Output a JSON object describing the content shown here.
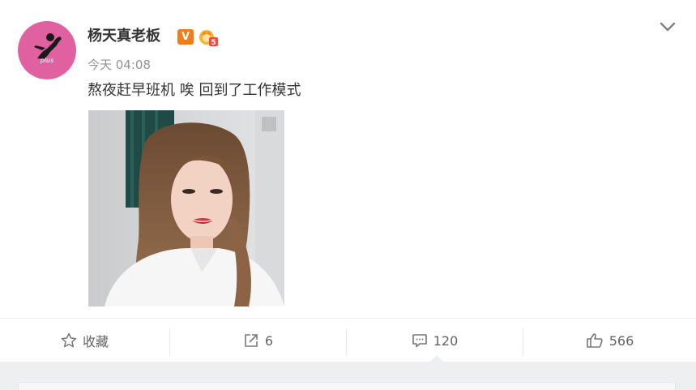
{
  "post": {
    "author": {
      "name": "杨天真老板",
      "avatar_text": "plus",
      "verified_badge": "V",
      "level_badge": "5"
    },
    "timestamp": "今天 04:08",
    "text": "熬夜赶早班机 唉 回到了工作模式",
    "menu_icon": "chevron-down-icon"
  },
  "actions": {
    "favorite": {
      "icon": "star-icon",
      "label": "收藏"
    },
    "repost": {
      "icon": "share-icon",
      "count": "6"
    },
    "comment": {
      "icon": "comment-icon",
      "count": "120"
    },
    "like": {
      "icon": "thumbs-up-icon",
      "count": "566"
    }
  },
  "colors": {
    "avatar_bg": "#e0619f",
    "verified_badge": "#f47a1a",
    "text_primary": "#333333",
    "text_secondary": "#939393",
    "page_bg": "#eeeff1"
  }
}
